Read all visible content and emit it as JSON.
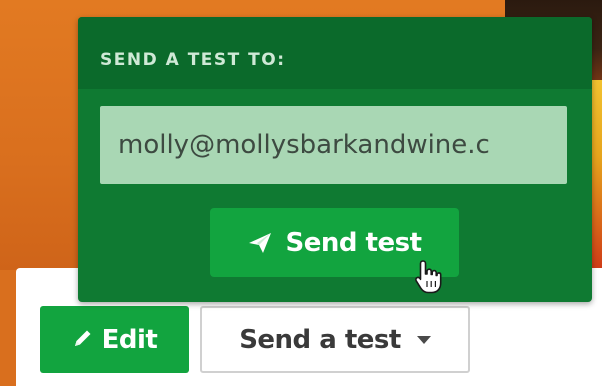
{
  "popover": {
    "title": "SEND A TEST TO:",
    "email_value": "molly@mollysbarkandwine.c",
    "send_button_label": "Send test",
    "send_icon": "paper-plane-icon"
  },
  "toolbar": {
    "edit_label": "Edit",
    "edit_icon": "pencil-icon",
    "send_a_test_label": "Send a test",
    "dropdown_icon": "caret-down-icon"
  },
  "colors": {
    "popover_bg": "#0f7a32",
    "popover_header_bg": "#0b6a2b",
    "primary_button": "#12a43f",
    "input_bg": "#a9d7b4",
    "background_orange": "#d96f1e"
  }
}
